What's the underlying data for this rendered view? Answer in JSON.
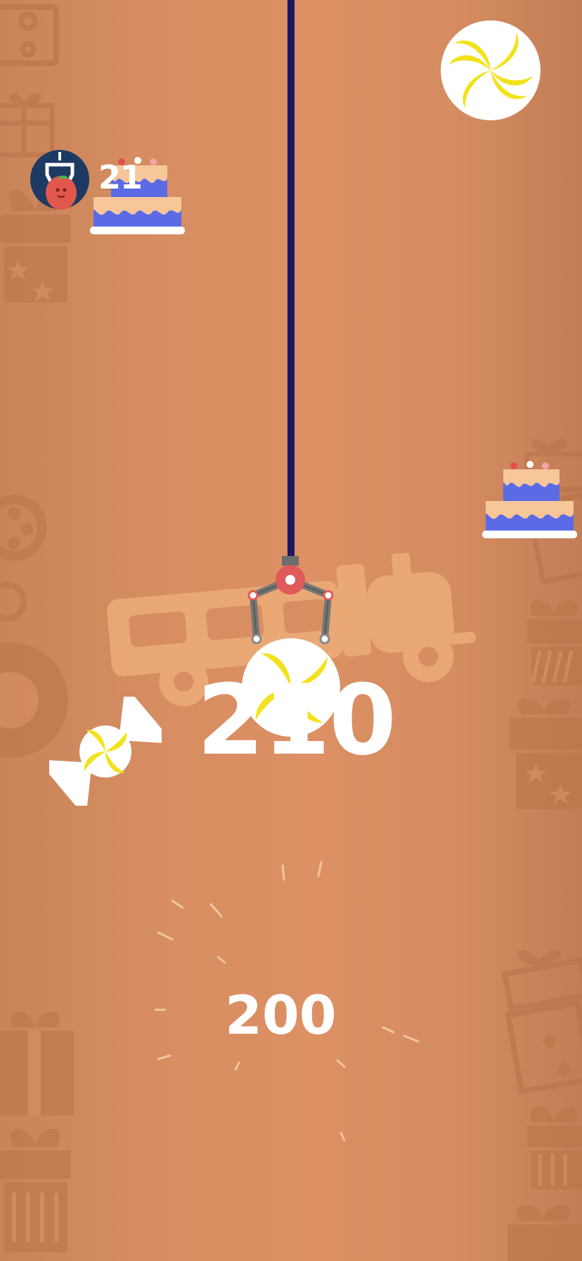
{
  "hud": {
    "level": "21",
    "avatar_icon": "claw-tomato-avatar-icon"
  },
  "game": {
    "score": "210",
    "points_popup": "200"
  },
  "items": {
    "hud_cake_icon": "cake-icon",
    "cake_right_icon": "cake-icon",
    "lollipop_top_icon": "swirl-candy-icon",
    "wrapped_candy_icon": "wrapped-candy-icon",
    "grabbed_candy_icon": "swirl-candy-icon",
    "claw_icon": "claw-icon"
  },
  "colors": {
    "background": "#d88e62",
    "rope": "#1c1660",
    "claw_hub": "#e05a5a",
    "cake_blue": "#5b6be6",
    "cake_cream": "#f7c79a",
    "candy_yellow": "#f2e21c"
  }
}
